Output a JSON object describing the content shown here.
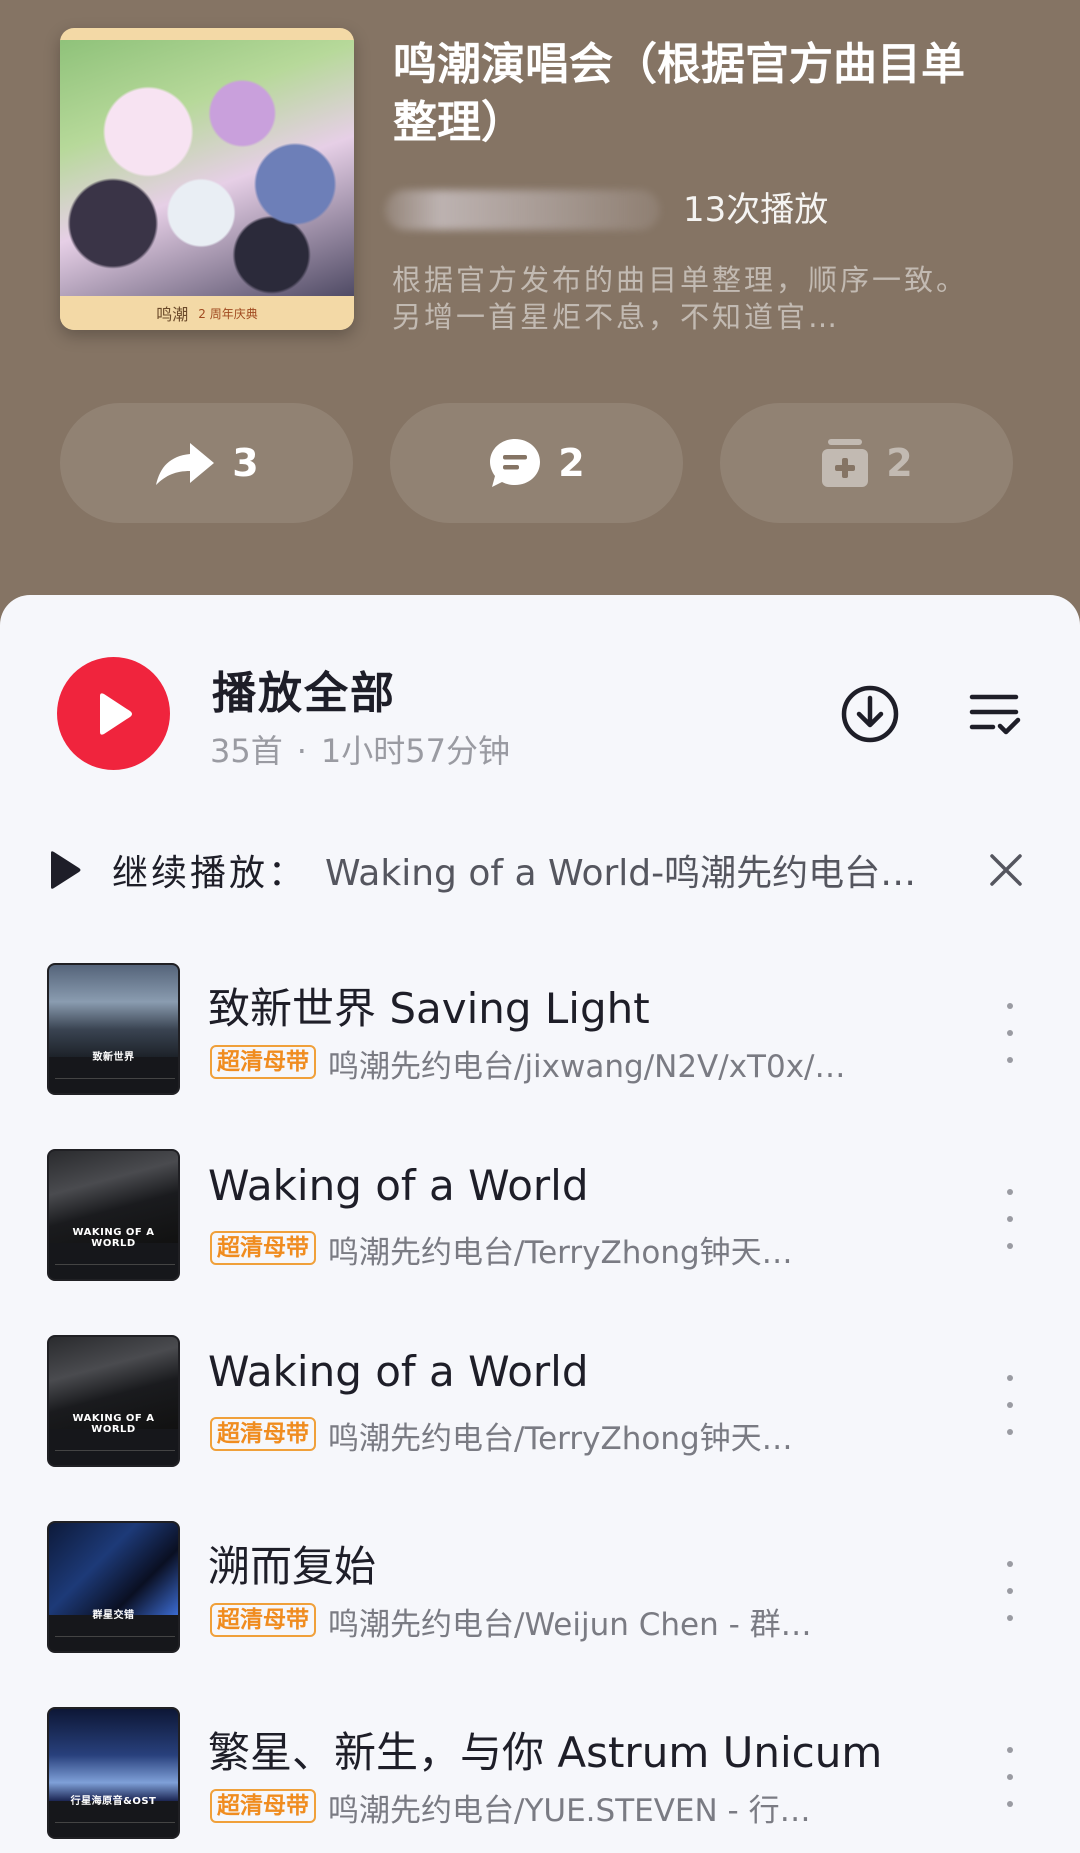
{
  "playlist": {
    "title": "鸣潮演唱会（根据官方曲目单整理）",
    "plays": "13次播放",
    "description": "根据官方发布的曲目单整理，顺序一致。另增一首星炬不息，不知道官…",
    "cover_brand": "鸣潮",
    "cover_sub": "2 周年庆典"
  },
  "actions": {
    "share_count": "3",
    "comment_count": "2",
    "collect_count": "2"
  },
  "play_all": {
    "label": "播放全部",
    "count": "35首",
    "separator": "·",
    "duration": "1小时57分钟"
  },
  "continue": {
    "label": "继续播放：",
    "track": "Waking of a World-鸣潮先约电台…"
  },
  "badge_label": "超清母带",
  "tracks": [
    {
      "title": "致新世界 Saving Light",
      "subtitle": "鸣潮先约电台/jixwang/N2V/xT0x/…",
      "cover_caption": "致新世界"
    },
    {
      "title": "Waking of a World",
      "subtitle": "鸣潮先约电台/TerryZhong钟天…",
      "cover_caption": "WAKING OF A WORLD"
    },
    {
      "title": "Waking of a World",
      "subtitle": "鸣潮先约电台/TerryZhong钟天…",
      "cover_caption": "WAKING OF A WORLD"
    },
    {
      "title": "溯而复始",
      "subtitle": "鸣潮先约电台/Weijun Chen - 群…",
      "cover_caption": "群星交错"
    },
    {
      "title": "繁星、新生，与你 Astrum Unicum",
      "subtitle": "鸣潮先约电台/YUE.STEVEN - 行…",
      "cover_caption": "行星海原音&OST"
    }
  ],
  "colors": {
    "header_bg": "#857464",
    "accent_red": "#f0243d",
    "badge_orange": "#f08c1f"
  }
}
